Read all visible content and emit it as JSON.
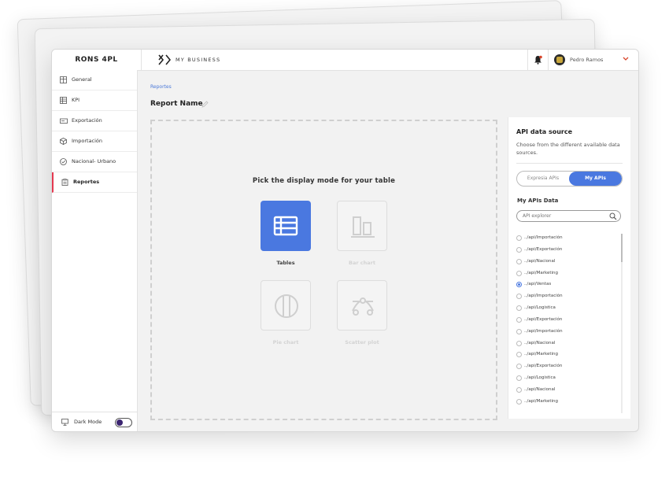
{
  "app": {
    "brand": "RONS 4PL",
    "business": "MY BUSINESS",
    "user": "Pedro Ramos"
  },
  "sidebar": {
    "items": [
      {
        "label": "General",
        "icon": "grid-icon"
      },
      {
        "label": "KPI",
        "icon": "table-icon"
      },
      {
        "label": "Exportación",
        "icon": "export-icon"
      },
      {
        "label": "Importación",
        "icon": "box-icon"
      },
      {
        "label": "Nacional- Urbano",
        "icon": "check-circle-icon"
      },
      {
        "label": "Reportes",
        "icon": "clipboard-icon",
        "active": true
      }
    ],
    "dark_mode_label": "Dark Mode",
    "dark_mode_on": false
  },
  "main": {
    "breadcrumb": "Reportes",
    "report_name": "Report Name",
    "pick_title": "Pick the display mode for your table",
    "modes": [
      {
        "label": "Tables",
        "icon": "table-icon",
        "selected": true
      },
      {
        "label": "Bar chart",
        "icon": "bar-chart-icon",
        "selected": false
      },
      {
        "label": "Pie chart",
        "icon": "pie-chart-icon",
        "selected": false
      },
      {
        "label": "Scatter plot",
        "icon": "scatter-plot-icon",
        "selected": false
      }
    ]
  },
  "panel": {
    "title": "API data source",
    "description": "Choose from the different available data sources.",
    "tabs": [
      "Expresia APIs",
      "My APIs"
    ],
    "active_tab": "My APIs",
    "subtitle": "My APIs Data",
    "search_placeholder": "API explorer",
    "apis": [
      "../api/Importación",
      "../api/Exportación",
      "../api/Nacional",
      "../api/Marketing",
      "../api/Ventas",
      "../api/Importación",
      "../api/Logistica",
      "../api/Exportación",
      "../api/Importación",
      "../api/Nacional",
      "../api/Marketing",
      "../api/Exportación",
      "../api/Logistica",
      "../api/Nacional",
      "../api/Marketing"
    ],
    "selected_api": "../api/Ventas"
  },
  "colors": {
    "accent": "#4a78e0",
    "active_nav": "#e53950",
    "notification": "#d8452b"
  }
}
